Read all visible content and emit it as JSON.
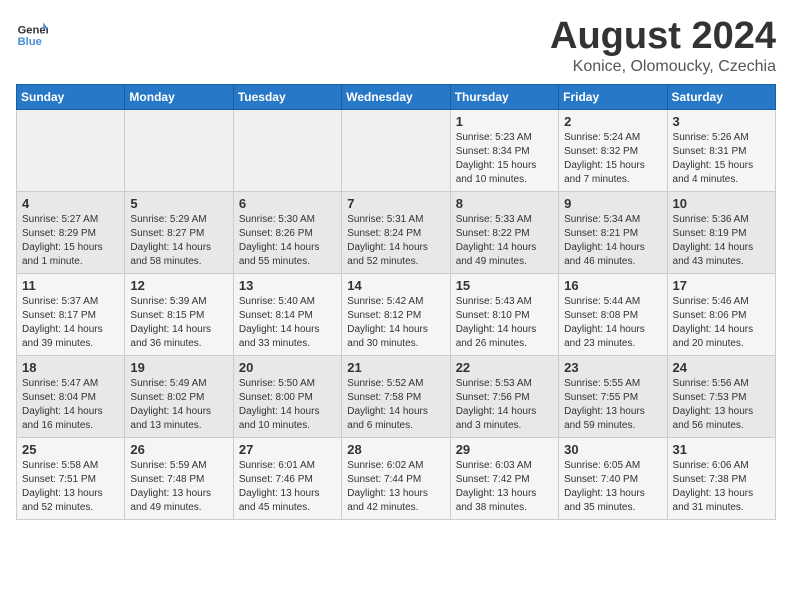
{
  "header": {
    "logo_general": "General",
    "logo_blue": "Blue",
    "title": "August 2024",
    "subtitle": "Konice, Olomoucky, Czechia"
  },
  "weekdays": [
    "Sunday",
    "Monday",
    "Tuesday",
    "Wednesday",
    "Thursday",
    "Friday",
    "Saturday"
  ],
  "weeks": [
    [
      {
        "day": "",
        "info": ""
      },
      {
        "day": "",
        "info": ""
      },
      {
        "day": "",
        "info": ""
      },
      {
        "day": "",
        "info": ""
      },
      {
        "day": "1",
        "info": "Sunrise: 5:23 AM\nSunset: 8:34 PM\nDaylight: 15 hours\nand 10 minutes."
      },
      {
        "day": "2",
        "info": "Sunrise: 5:24 AM\nSunset: 8:32 PM\nDaylight: 15 hours\nand 7 minutes."
      },
      {
        "day": "3",
        "info": "Sunrise: 5:26 AM\nSunset: 8:31 PM\nDaylight: 15 hours\nand 4 minutes."
      }
    ],
    [
      {
        "day": "4",
        "info": "Sunrise: 5:27 AM\nSunset: 8:29 PM\nDaylight: 15 hours\nand 1 minute."
      },
      {
        "day": "5",
        "info": "Sunrise: 5:29 AM\nSunset: 8:27 PM\nDaylight: 14 hours\nand 58 minutes."
      },
      {
        "day": "6",
        "info": "Sunrise: 5:30 AM\nSunset: 8:26 PM\nDaylight: 14 hours\nand 55 minutes."
      },
      {
        "day": "7",
        "info": "Sunrise: 5:31 AM\nSunset: 8:24 PM\nDaylight: 14 hours\nand 52 minutes."
      },
      {
        "day": "8",
        "info": "Sunrise: 5:33 AM\nSunset: 8:22 PM\nDaylight: 14 hours\nand 49 minutes."
      },
      {
        "day": "9",
        "info": "Sunrise: 5:34 AM\nSunset: 8:21 PM\nDaylight: 14 hours\nand 46 minutes."
      },
      {
        "day": "10",
        "info": "Sunrise: 5:36 AM\nSunset: 8:19 PM\nDaylight: 14 hours\nand 43 minutes."
      }
    ],
    [
      {
        "day": "11",
        "info": "Sunrise: 5:37 AM\nSunset: 8:17 PM\nDaylight: 14 hours\nand 39 minutes."
      },
      {
        "day": "12",
        "info": "Sunrise: 5:39 AM\nSunset: 8:15 PM\nDaylight: 14 hours\nand 36 minutes."
      },
      {
        "day": "13",
        "info": "Sunrise: 5:40 AM\nSunset: 8:14 PM\nDaylight: 14 hours\nand 33 minutes."
      },
      {
        "day": "14",
        "info": "Sunrise: 5:42 AM\nSunset: 8:12 PM\nDaylight: 14 hours\nand 30 minutes."
      },
      {
        "day": "15",
        "info": "Sunrise: 5:43 AM\nSunset: 8:10 PM\nDaylight: 14 hours\nand 26 minutes."
      },
      {
        "day": "16",
        "info": "Sunrise: 5:44 AM\nSunset: 8:08 PM\nDaylight: 14 hours\nand 23 minutes."
      },
      {
        "day": "17",
        "info": "Sunrise: 5:46 AM\nSunset: 8:06 PM\nDaylight: 14 hours\nand 20 minutes."
      }
    ],
    [
      {
        "day": "18",
        "info": "Sunrise: 5:47 AM\nSunset: 8:04 PM\nDaylight: 14 hours\nand 16 minutes."
      },
      {
        "day": "19",
        "info": "Sunrise: 5:49 AM\nSunset: 8:02 PM\nDaylight: 14 hours\nand 13 minutes."
      },
      {
        "day": "20",
        "info": "Sunrise: 5:50 AM\nSunset: 8:00 PM\nDaylight: 14 hours\nand 10 minutes."
      },
      {
        "day": "21",
        "info": "Sunrise: 5:52 AM\nSunset: 7:58 PM\nDaylight: 14 hours\nand 6 minutes."
      },
      {
        "day": "22",
        "info": "Sunrise: 5:53 AM\nSunset: 7:56 PM\nDaylight: 14 hours\nand 3 minutes."
      },
      {
        "day": "23",
        "info": "Sunrise: 5:55 AM\nSunset: 7:55 PM\nDaylight: 13 hours\nand 59 minutes."
      },
      {
        "day": "24",
        "info": "Sunrise: 5:56 AM\nSunset: 7:53 PM\nDaylight: 13 hours\nand 56 minutes."
      }
    ],
    [
      {
        "day": "25",
        "info": "Sunrise: 5:58 AM\nSunset: 7:51 PM\nDaylight: 13 hours\nand 52 minutes."
      },
      {
        "day": "26",
        "info": "Sunrise: 5:59 AM\nSunset: 7:48 PM\nDaylight: 13 hours\nand 49 minutes."
      },
      {
        "day": "27",
        "info": "Sunrise: 6:01 AM\nSunset: 7:46 PM\nDaylight: 13 hours\nand 45 minutes."
      },
      {
        "day": "28",
        "info": "Sunrise: 6:02 AM\nSunset: 7:44 PM\nDaylight: 13 hours\nand 42 minutes."
      },
      {
        "day": "29",
        "info": "Sunrise: 6:03 AM\nSunset: 7:42 PM\nDaylight: 13 hours\nand 38 minutes."
      },
      {
        "day": "30",
        "info": "Sunrise: 6:05 AM\nSunset: 7:40 PM\nDaylight: 13 hours\nand 35 minutes."
      },
      {
        "day": "31",
        "info": "Sunrise: 6:06 AM\nSunset: 7:38 PM\nDaylight: 13 hours\nand 31 minutes."
      }
    ]
  ]
}
